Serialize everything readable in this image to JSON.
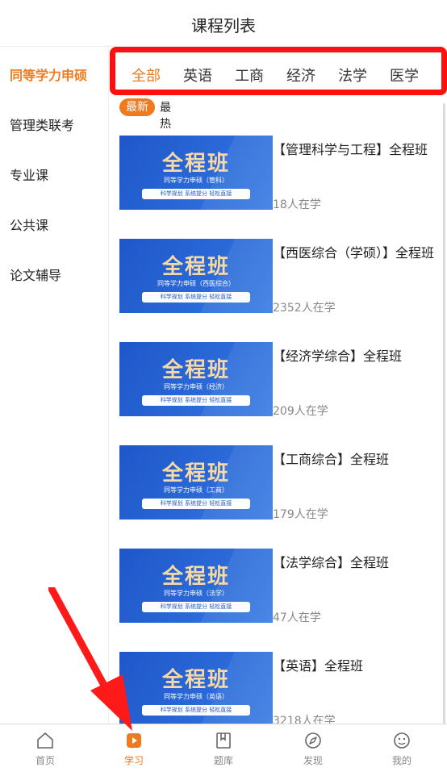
{
  "header": {
    "title": "课程列表"
  },
  "sidebar": {
    "items": [
      {
        "label": "同等学力申硕",
        "active": true
      },
      {
        "label": "管理类联考"
      },
      {
        "label": "专业课"
      },
      {
        "label": "公共课"
      },
      {
        "label": "论文辅导"
      }
    ]
  },
  "tabs": [
    {
      "label": "全部",
      "active": true
    },
    {
      "label": "英语"
    },
    {
      "label": "工商"
    },
    {
      "label": "经济"
    },
    {
      "label": "法学"
    },
    {
      "label": "医学"
    }
  ],
  "sort": {
    "newest": "最新",
    "hot": "最热"
  },
  "courses": [
    {
      "title": "【管理科学与工程】全程班",
      "learners": "18人在学",
      "thumb_big": "全程班",
      "thumb_sub": "同等学力申硕（管科）",
      "thumb_pill": "科学规划 系统提分 轻松直接"
    },
    {
      "title": "【西医综合（学硕）】全程班",
      "learners": "2352人在学",
      "thumb_big": "全程班",
      "thumb_sub": "同等学力申硕（西医综合）",
      "thumb_pill": "科学规划 系统提分 轻松直接"
    },
    {
      "title": "【经济学综合】全程班",
      "learners": "209人在学",
      "thumb_big": "全程班",
      "thumb_sub": "同等学力申硕（经济）",
      "thumb_pill": "科学规划 系统提分 轻松直接"
    },
    {
      "title": "【工商综合】全程班",
      "learners": "179人在学",
      "thumb_big": "全程班",
      "thumb_sub": "同等学力申硕（工商）",
      "thumb_pill": "科学规划 系统提分 轻松直接"
    },
    {
      "title": "【法学综合】全程班",
      "learners": "47人在学",
      "thumb_big": "全程班",
      "thumb_sub": "同等学力申硕（法学）",
      "thumb_pill": "科学规划 系统提分 轻松直接"
    },
    {
      "title": "【英语】全程班",
      "learners": "3218人在学",
      "thumb_big": "全程班",
      "thumb_sub": "同等学力申硕（英语）",
      "thumb_pill": "科学规划 系统提分 轻松直接"
    }
  ],
  "tabbar": [
    {
      "label": "首页",
      "icon": "home-icon"
    },
    {
      "label": "学习",
      "icon": "play-icon",
      "active": true
    },
    {
      "label": "题库",
      "icon": "book-icon"
    },
    {
      "label": "发现",
      "icon": "compass-icon"
    },
    {
      "label": "我的",
      "icon": "profile-icon"
    }
  ],
  "colors": {
    "accent": "#f07a1e",
    "highlight": "#ff1010",
    "thumb_blue": "#1f57c9"
  }
}
